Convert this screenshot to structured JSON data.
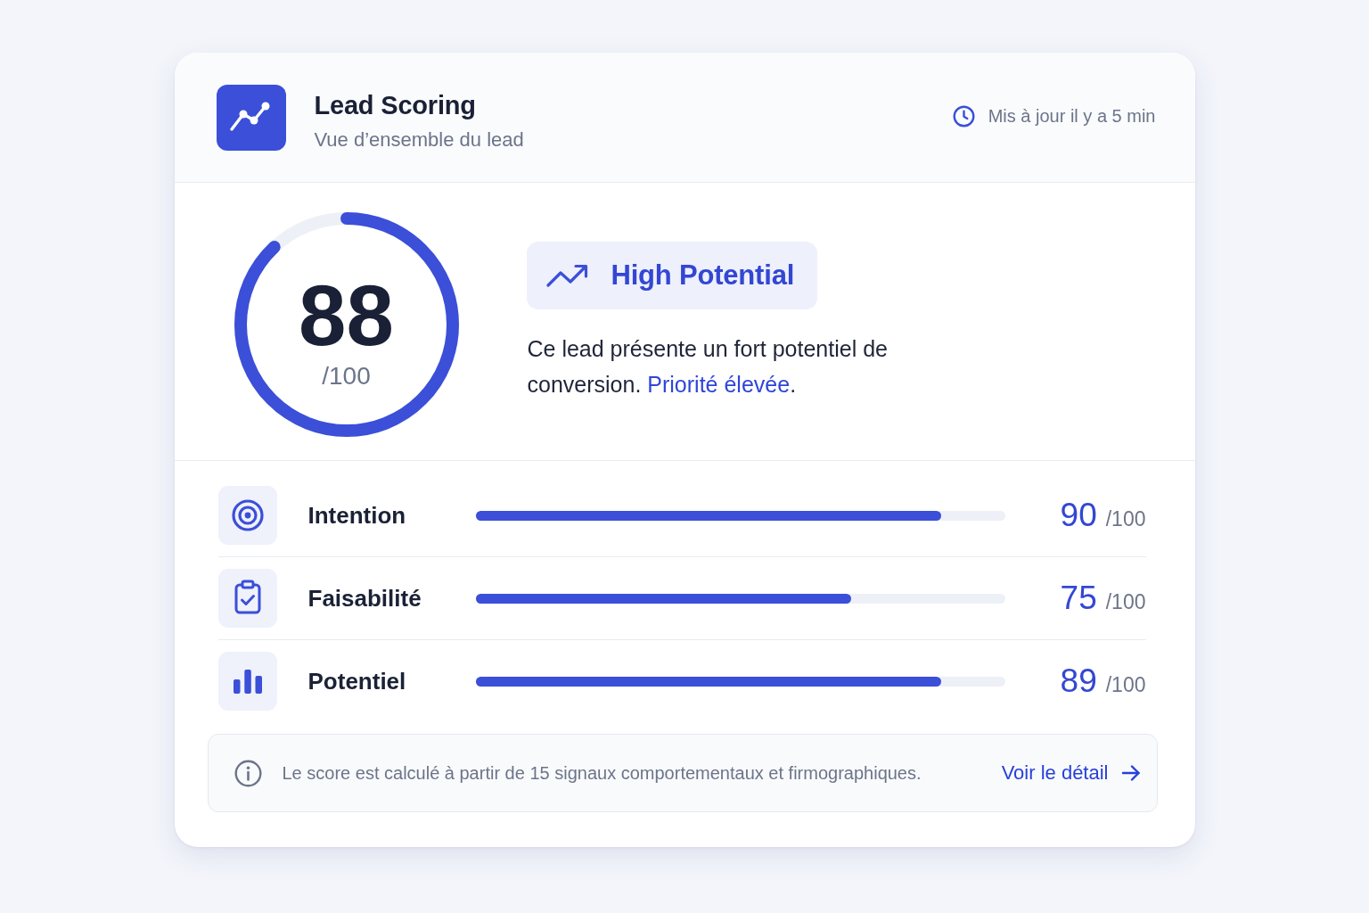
{
  "header": {
    "title": "Lead Scoring",
    "subtitle": "Vue d’ensemble du lead",
    "updated": "Mis à jour il y a 5 min"
  },
  "score": {
    "value": "88",
    "max": "/100",
    "level": 0.88
  },
  "badge": {
    "label": "High Potential"
  },
  "description": {
    "text": "Ce lead présente un fort potentiel de conversion.",
    "highlight": "Priorité élevée",
    "end": "."
  },
  "metrics": [
    {
      "kind": "target",
      "label": "Intention",
      "level": 0.88,
      "value": "90",
      "max": "/100"
    },
    {
      "kind": "clipboard",
      "label": "Faisabilité",
      "level": 0.71,
      "value": "75",
      "max": "/100"
    },
    {
      "kind": "bars",
      "label": "Potentiel",
      "level": 0.88,
      "value": "89",
      "max": "/100"
    }
  ],
  "footer": {
    "note": "Le score est calculé à partir de 15 signaux comportementaux et firmographiques.",
    "link": "Voir le détail"
  }
}
